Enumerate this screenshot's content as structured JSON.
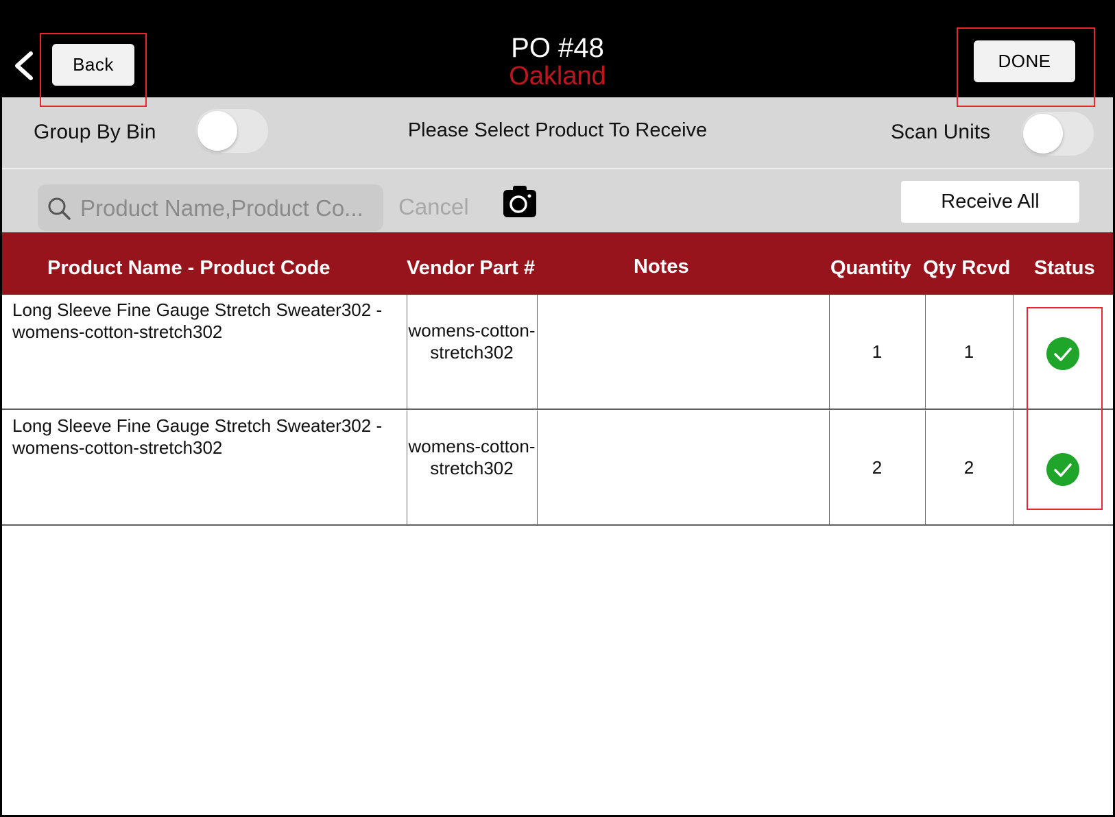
{
  "header": {
    "title": "PO #48",
    "subtitle": "Oakland",
    "back_label": "Back",
    "done_label": "DONE"
  },
  "options": {
    "group_by_bin_label": "Group By Bin",
    "group_by_bin_on": false,
    "prompt": "Please Select Product To Receive",
    "scan_units_label": "Scan Units",
    "scan_units_on": false
  },
  "search": {
    "placeholder": "Product Name,Product Co...",
    "value": "",
    "cancel_label": "Cancel",
    "receive_all_label": "Receive All"
  },
  "table": {
    "columns": [
      "Product Name - Product Code",
      "Vendor Part #",
      "Notes",
      "Quantity",
      "Qty Rcvd",
      "Status"
    ],
    "rows": [
      {
        "name": "Long Sleeve Fine Gauge Stretch Sweater302 - womens-cotton-stretch302",
        "vendor_part": "womens-cotton-stretch302",
        "notes": "",
        "quantity": "1",
        "qty_rcvd": "1",
        "status": "check-circle-icon"
      },
      {
        "name": "Long Sleeve Fine Gauge Stretch Sweater302 - womens-cotton-stretch302",
        "vendor_part": "womens-cotton-stretch302",
        "notes": "",
        "quantity": "2",
        "qty_rcvd": "2",
        "status": "check-circle-icon"
      }
    ]
  },
  "colors": {
    "accent": "#97141c",
    "subtitle": "#c0151f",
    "status_ok": "#1ea52a",
    "highlight": "#e8262b"
  }
}
